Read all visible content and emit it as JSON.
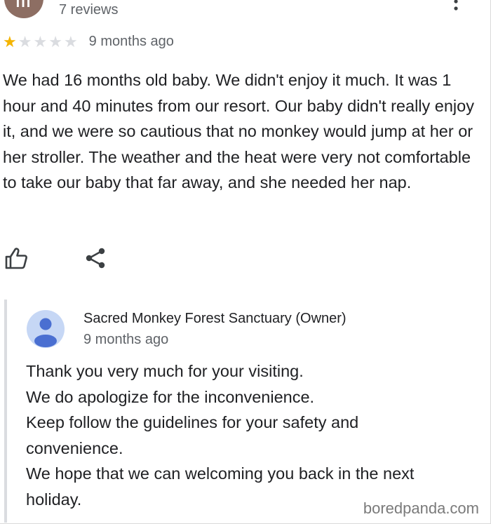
{
  "review": {
    "reviewer_initials": "III",
    "review_count": "7 reviews",
    "rating": 1,
    "max_rating": 5,
    "time_ago": "9 months ago",
    "text": "We had 16 months old baby. We didn't enjoy it much. It was 1 hour and 40 minutes from our resort. Our baby didn't really enjoy it, and we were so cautious that no monkey would jump at her or her stroller. The weather and the heat were very not comfortable to take our baby that far away, and she needed her nap."
  },
  "actions": {
    "like_icon": "thumbs-up-icon",
    "share_icon": "share-icon"
  },
  "owner_reply": {
    "name": "Sacred Monkey Forest Sanctuary (Owner)",
    "time_ago": "9 months ago",
    "lines": [
      "Thank you very much for your visiting.",
      "We do apologize for the inconvenience.",
      "Keep follow the guidelines for your safety and",
      "convenience.",
      "We hope that we can welcoming you back in the next",
      "holiday."
    ]
  },
  "watermark": "boredpanda.com",
  "colors": {
    "star_on": "#f4b400",
    "star_off": "#dadce0",
    "secondary_text": "#5f6368",
    "reply_bar": "#dadce0",
    "owner_avatar_bg": "#c6d7f5",
    "owner_avatar_fg": "#4a6fd1"
  }
}
